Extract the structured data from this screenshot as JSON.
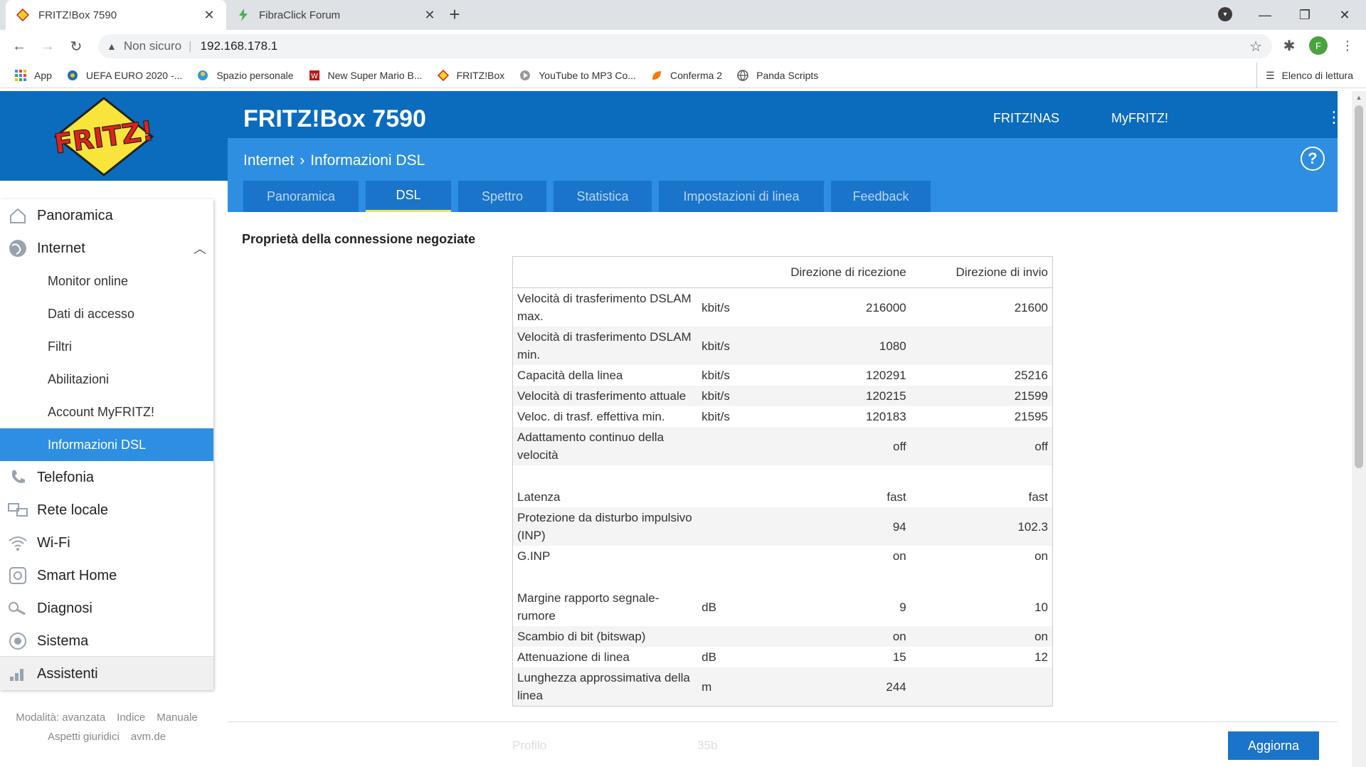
{
  "browser": {
    "tabs": [
      {
        "title": "FRITZ!Box 7590",
        "icon": "fritz-favicon",
        "active": true
      },
      {
        "title": "FibraClick Forum",
        "icon": "lightning-favicon",
        "active": false
      }
    ],
    "address": {
      "security": "Non sicuro",
      "url": "192.168.178.1"
    },
    "profile_initial": "F",
    "bookmarks": [
      {
        "label": "App",
        "icon": "apps-grid-icon"
      },
      {
        "label": "UEFA EURO 2020 -...",
        "icon": "uefa-icon"
      },
      {
        "label": "Spazio personale",
        "icon": "personal-space-icon"
      },
      {
        "label": "New Super Mario B...",
        "icon": "mario-icon"
      },
      {
        "label": "FRITZ!Box",
        "icon": "fritz-favicon"
      },
      {
        "label": "YouTube to MP3 Co...",
        "icon": "youtube-mp3-icon"
      },
      {
        "label": "Conferma 2",
        "icon": "conferma-icon"
      },
      {
        "label": "Panda Scripts",
        "icon": "globe-icon"
      }
    ],
    "reading_list": "Elenco di lettura"
  },
  "header": {
    "product": "FRITZ!Box 7590",
    "links": [
      "FRITZ!NAS",
      "MyFRITZ!"
    ],
    "breadcrumb": [
      "Internet",
      "Informazioni DSL"
    ],
    "help": "?"
  },
  "tabs": [
    "Panoramica",
    "DSL",
    "Spettro",
    "Statistica",
    "Impostazioni di linea",
    "Feedback"
  ],
  "active_tab": "DSL",
  "sidebar": {
    "items": [
      {
        "label": "Panoramica",
        "icon": "home-icon"
      },
      {
        "label": "Internet",
        "icon": "globe-icon"
      },
      {
        "label": "Telefonia",
        "icon": "phone-icon"
      },
      {
        "label": "Rete locale",
        "icon": "network-icon"
      },
      {
        "label": "Wi-Fi",
        "icon": "wifi-icon"
      },
      {
        "label": "Smart Home",
        "icon": "smart-home-icon"
      },
      {
        "label": "Diagnosi",
        "icon": "diagnosis-icon"
      },
      {
        "label": "Sistema",
        "icon": "system-icon"
      },
      {
        "label": "Assistenti",
        "icon": "assistant-icon"
      }
    ],
    "internet_sub": [
      "Monitor online",
      "Dati di accesso",
      "Filtri",
      "Abilitazioni",
      "Account MyFRITZ!",
      "Informazioni DSL"
    ],
    "active_sub": "Informazioni DSL",
    "footer": {
      "row1": [
        "Modalità: avanzata",
        "Indice",
        "Manuale"
      ],
      "row2": [
        "Aspetti giuridici",
        "avm.de"
      ]
    }
  },
  "content": {
    "section_title": "Proprietà della connessione negoziate",
    "columns": [
      "",
      "",
      "Direzione di ricezione",
      "Direzione di invio"
    ],
    "rows": [
      {
        "label": "Velocità di trasferimento DSLAM max.",
        "unit": "kbit/s",
        "rx": "216000",
        "tx": "21600"
      },
      {
        "label": "Velocità di trasferimento DSLAM min.",
        "unit": "kbit/s",
        "rx": "1080",
        "tx": ""
      },
      {
        "label": "Capacità della linea",
        "unit": "kbit/s",
        "rx": "120291",
        "tx": "25216"
      },
      {
        "label": "Velocità di trasferimento attuale",
        "unit": "kbit/s",
        "rx": "120215",
        "tx": "21599"
      },
      {
        "label": "Veloc. di trasf. effettiva min.",
        "unit": "kbit/s",
        "rx": "120183",
        "tx": "21595"
      },
      {
        "label": "Adattamento continuo della velocità",
        "unit": "",
        "rx": "off",
        "tx": "off"
      },
      {
        "spacer": true
      },
      {
        "label": "Latenza",
        "unit": "",
        "rx": "fast",
        "tx": "fast"
      },
      {
        "label": "Protezione da disturbo impulsivo (INP)",
        "unit": "",
        "rx": "94",
        "tx": "102.3"
      },
      {
        "label": "G.INP",
        "unit": "",
        "rx": "on",
        "tx": "on"
      },
      {
        "spacer": true
      },
      {
        "label": "Margine rapporto segnale-rumore",
        "unit": "dB",
        "rx": "9",
        "tx": "10"
      },
      {
        "label": "Scambio di bit (bitswap)",
        "unit": "",
        "rx": "on",
        "tx": "on"
      },
      {
        "label": "Attenuazione di linea",
        "unit": "dB",
        "rx": "15",
        "tx": "12"
      },
      {
        "label": "Lunghezza approssimativa della linea",
        "unit": "m",
        "rx": "244",
        "tx": ""
      }
    ],
    "faded_row": {
      "label": "Profilo",
      "unit": "35b"
    },
    "update_button": "Aggiorna"
  },
  "colors": {
    "brand_blue": "#0b6bbd",
    "accent_blue": "#2d8ee2",
    "tab_underline": "#f5e15a"
  }
}
